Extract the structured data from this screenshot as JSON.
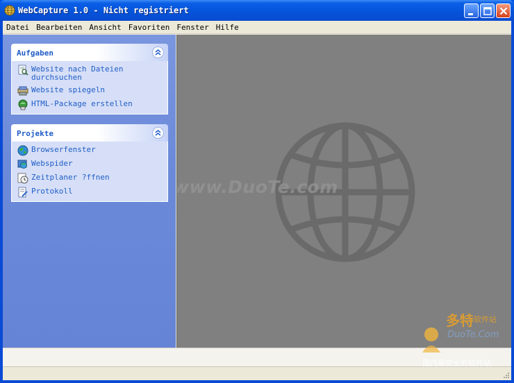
{
  "window": {
    "title": "WebCapture 1.0 - Nicht registriert"
  },
  "menu": {
    "items": [
      {
        "label": "Datei"
      },
      {
        "label": "Bearbeiten"
      },
      {
        "label": "Ansicht"
      },
      {
        "label": "Favoriten"
      },
      {
        "label": "Fenster"
      },
      {
        "label": "Hilfe"
      }
    ]
  },
  "sidebar": {
    "tasks_panel": {
      "title": "Aufgaben",
      "items": [
        {
          "label": "Website nach Dateien durchsuchen",
          "icon": "search-document-icon"
        },
        {
          "label": "Website spiegeln",
          "icon": "mirror-icon"
        },
        {
          "label": "HTML-Package erstellen",
          "icon": "package-icon"
        }
      ]
    },
    "projects_panel": {
      "title": "Projekte",
      "items": [
        {
          "label": "Browserfenster",
          "icon": "globe-icon"
        },
        {
          "label": "Webspider",
          "icon": "spider-icon"
        },
        {
          "label": "Zeitplaner ?ffnen",
          "icon": "clock-icon"
        },
        {
          "label": "Protokoll",
          "icon": "log-icon"
        }
      ]
    }
  },
  "content": {
    "watermark": "www.DuoTe.com"
  },
  "corner_logo": {
    "name_cn": "多特",
    "sub_cn": "软件站",
    "name_en": "DuoTe.Com",
    "tagline": "国内最安全的软件站"
  },
  "colors": {
    "title_bar": "#0553d9",
    "sidebar": "#6b8ad9",
    "link": "#215dc6",
    "content_bg": "#808080"
  }
}
